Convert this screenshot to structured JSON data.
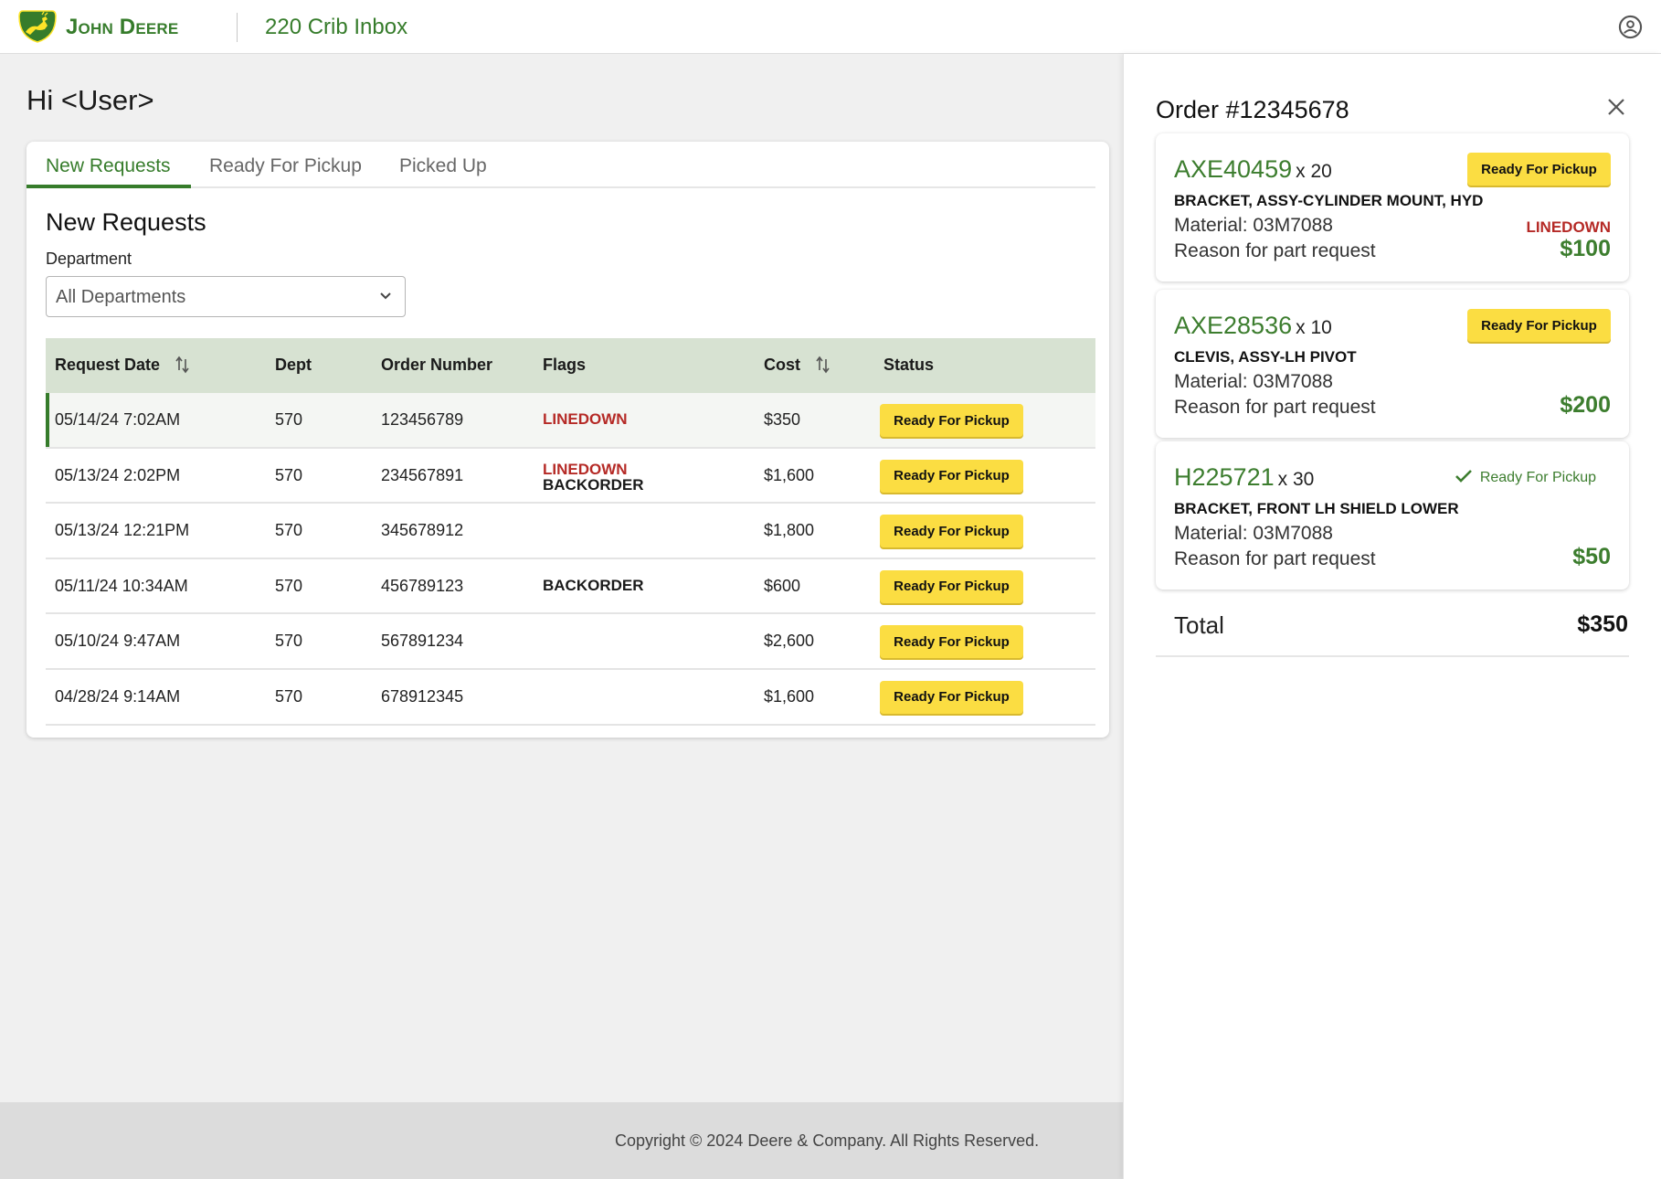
{
  "header": {
    "brand": "John Deere",
    "app_title": "220 Crib Inbox",
    "icons": {
      "logo": "john-deere-leaping-deer-logo",
      "profile": "user-circle-icon"
    }
  },
  "greeting": "Hi <User>",
  "tabs": [
    {
      "label": "New Requests",
      "active": true
    },
    {
      "label": "Ready For Pickup",
      "active": false
    },
    {
      "label": "Picked Up",
      "active": false
    }
  ],
  "section_title": "New Requests",
  "filter": {
    "label": "Department",
    "value": "All Departments"
  },
  "table": {
    "columns": [
      "Request Date",
      "Dept",
      "Order Number",
      "Flags",
      "Cost",
      "Status"
    ],
    "sortable": [
      "Request Date",
      "Cost"
    ],
    "rows": [
      {
        "date": "05/14/24 7:02AM",
        "dept": "570",
        "order": "123456789",
        "flags": [
          "LINEDOWN"
        ],
        "cost": "$350",
        "status": "Ready For Pickup",
        "selected": true
      },
      {
        "date": "05/13/24 2:02PM",
        "dept": "570",
        "order": "234567891",
        "flags": [
          "LINEDOWN",
          "BACKORDER"
        ],
        "cost": "$1,600",
        "status": "Ready For Pickup"
      },
      {
        "date": "05/13/24 12:21PM",
        "dept": "570",
        "order": "345678912",
        "flags": [],
        "cost": "$1,800",
        "status": "Ready For Pickup"
      },
      {
        "date": "05/11/24 10:34AM",
        "dept": "570",
        "order": "456789123",
        "flags": [
          "BACKORDER"
        ],
        "cost": "$600",
        "status": "Ready For Pickup"
      },
      {
        "date": "05/10/24 9:47AM",
        "dept": "570",
        "order": "567891234",
        "flags": [],
        "cost": "$2,600",
        "status": "Ready For Pickup"
      },
      {
        "date": "04/28/24 9:14AM",
        "dept": "570",
        "order": "678912345",
        "flags": [],
        "cost": "$1,600",
        "status": "Ready For Pickup"
      }
    ]
  },
  "footer": {
    "copyright": "Copyright © 2024 Deere & Company. All Rights Reserved."
  },
  "order_panel": {
    "title": "Order #12345678",
    "items": [
      {
        "part": "AXE40459",
        "qty": "x 20",
        "description": "BRACKET, ASSY-CYLINDER MOUNT, HYD",
        "material": "Material: 03M7088",
        "reason": "Reason for part request",
        "status": "Ready For Pickup",
        "status_confirmed": false,
        "flag": "LINEDOWN",
        "price": "$100"
      },
      {
        "part": "AXE28536",
        "qty": "x 10",
        "description": "CLEVIS, ASSY-LH PIVOT",
        "material": "Material: 03M7088",
        "reason": "Reason for part request",
        "status": "Ready For Pickup",
        "status_confirmed": false,
        "flag": "",
        "price": "$200"
      },
      {
        "part": "H225721",
        "qty": "x 30",
        "description": "BRACKET, FRONT LH SHIELD LOWER",
        "material": "Material: 03M7088",
        "reason": "Reason for part request",
        "status": "Ready For Pickup",
        "status_confirmed": true,
        "flag": "",
        "price": "$50"
      }
    ],
    "total_label": "Total",
    "total_value": "$350"
  },
  "colors": {
    "brand_green": "#367c2b",
    "brand_yellow": "#fbdd42",
    "linedown_red": "#b52a26",
    "table_header": "#d7e2d2"
  }
}
